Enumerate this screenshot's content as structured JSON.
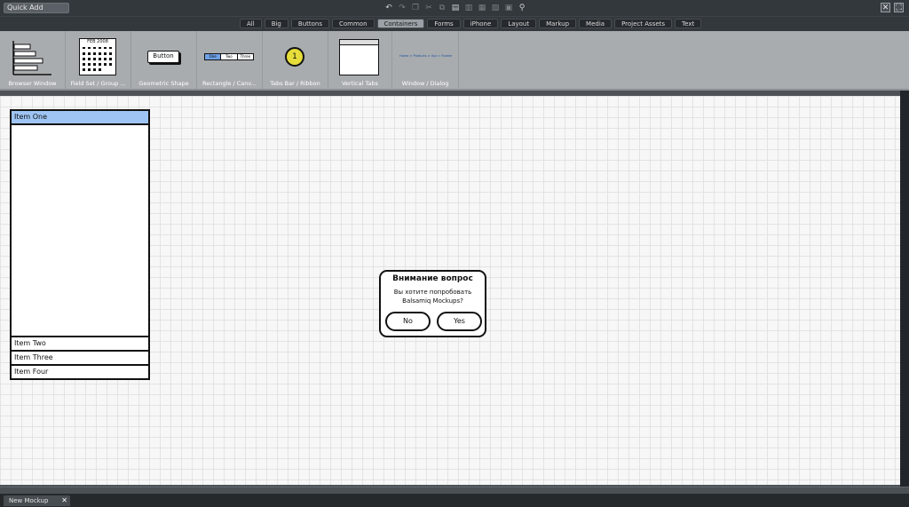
{
  "topbar": {
    "quick_add": "Quick Add",
    "icons": [
      "undo-icon",
      "redo-icon",
      "copy-icon",
      "cut-icon",
      "duplicate-icon",
      "paste-icon",
      "delete-icon",
      "group-icon",
      "ungroup-icon",
      "lock-icon",
      "search-icon"
    ],
    "win_icons": [
      "close-icon",
      "fullscreen-icon"
    ]
  },
  "categories": {
    "tabs": [
      "All",
      "Big",
      "Buttons",
      "Common",
      "Containers",
      "Forms",
      "iPhone",
      "Layout",
      "Markup",
      "Media",
      "Project Assets",
      "Text"
    ],
    "active": "Containers"
  },
  "ribbon": {
    "components": [
      {
        "label": "Browser Window"
      },
      {
        "label": "Field Set / Group ..."
      },
      {
        "label": "Geometric Shape",
        "thumb_text": "Button"
      },
      {
        "label": "Rectangle / Canv...",
        "thumb_tabs": [
          "One",
          "Two",
          "Three"
        ]
      },
      {
        "label": "Tabs Bar / Ribbon",
        "thumb_text": "1"
      },
      {
        "label": "Vertical Tabs"
      },
      {
        "label": "Window / Dialog",
        "thumb_crumbs": "Home > Products > Xyz > Flooter"
      }
    ],
    "calendar_title": "FEB 2008"
  },
  "mockup": {
    "accordion": {
      "items": [
        "Item One",
        "Item Two",
        "Item Three",
        "Item Four"
      ],
      "selected_color": "#9ec4f4"
    },
    "dialog": {
      "title": "Внимание вопрос",
      "line1": "Вы хотите попробовать",
      "line2": "Balsamiq Mockups?",
      "no": "No",
      "yes": "Yes"
    }
  },
  "bottombar": {
    "doc_tab": "New Mockup",
    "close": "✕"
  },
  "colors": {
    "chrome": "#33383d",
    "ribbon": "#a9acaf",
    "canvas": "#f7f7f7"
  }
}
